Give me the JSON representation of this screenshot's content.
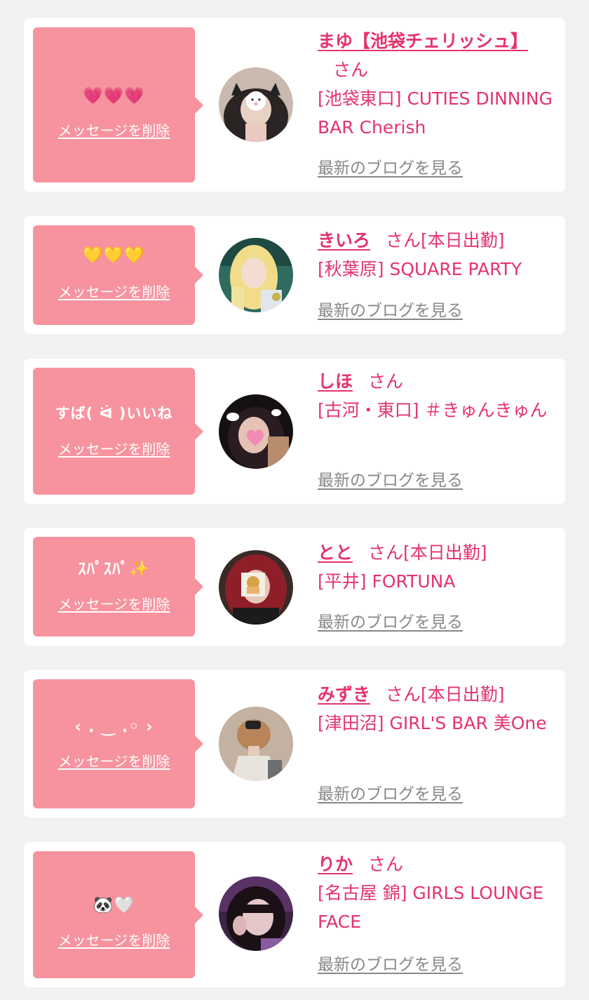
{
  "theme": {
    "accent": "#e5336b",
    "bubble": "#f7939e",
    "card_bg": "#ffffff",
    "page_bg": "#f2f2f2",
    "link_gray": "#888888"
  },
  "messages": [
    {
      "bubble_text": "💗💗💗",
      "delete_label": "メッセージを削除",
      "cast_name": "まゆ【池袋チェリッシュ】",
      "honorific": "さん",
      "today_badge": "",
      "shop": "[池袋東口] CUTIES DINNING BAR Cherish",
      "blog_link": "最新のブログを見る",
      "avatar_icon": "cat-ear-girl-photo"
    },
    {
      "bubble_text": "💛💛💛",
      "delete_label": "メッセージを削除",
      "cast_name": "きいろ",
      "honorific": "さん",
      "today_badge": "[本日出勤]",
      "shop": "[秋葉原] SQUARE PARTY",
      "blog_link": "最新のブログを見る",
      "avatar_icon": "blonde-girl-photo"
    },
    {
      "bubble_text": "すば( ᐛ )いいね",
      "delete_label": "メッセージを削除",
      "cast_name": "しほ",
      "honorific": "さん",
      "today_badge": "",
      "shop": "[古河・東口] ＃きゅんきゅん",
      "blog_link": "最新のブログを見る",
      "avatar_icon": "heart-face-girl-photo"
    },
    {
      "bubble_text": "ｽﾊﾟｽﾊﾟ✨",
      "delete_label": "メッセージを削除",
      "cast_name": "とと",
      "honorific": "さん",
      "today_badge": "[本日出勤]",
      "shop": "[平井] FORTUNA",
      "blog_link": "最新のブログを見る",
      "avatar_icon": "red-hair-girl-photo"
    },
    {
      "bubble_text": "‹ . ‿ .◦ ›",
      "delete_label": "メッセージを削除",
      "cast_name": "みずき",
      "honorific": "さん",
      "today_badge": "[本日出勤]",
      "shop": "[津田沼] GIRL'S BAR 美One",
      "blog_link": "最新のブログを見る",
      "avatar_icon": "hair-clip-back-photo"
    },
    {
      "bubble_text": "🐼🤍",
      "delete_label": "メッセージを削除",
      "cast_name": "りか",
      "honorific": "さん",
      "today_badge": "",
      "shop": "[名古屋 錦] GIRLS LOUNGE FACE",
      "blog_link": "最新のブログを見る",
      "avatar_icon": "purple-light-girl-photo"
    }
  ]
}
